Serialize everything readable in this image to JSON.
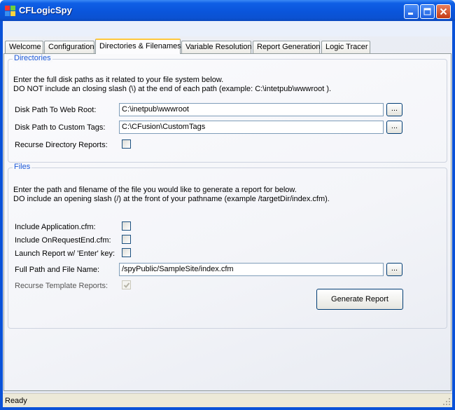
{
  "window": {
    "title": "CFLogicSpy"
  },
  "tabs": [
    {
      "label": "Welcome"
    },
    {
      "label": "Configuration"
    },
    {
      "label": "Directories & Filenames"
    },
    {
      "label": "Variable Resolution"
    },
    {
      "label": "Report Generation"
    },
    {
      "label": "Logic Tracer"
    }
  ],
  "directories": {
    "legend": "Directories",
    "instruction_1": "Enter the  full disk paths as it related to your file system below.",
    "instruction_2": "DO NOT include an closing slash (\\) at the end of each path  (example: C:\\intetpub\\wwwroot ).",
    "web_root_label": "Disk Path To Web Root:",
    "web_root_value": "C:\\inetpub\\wwwroot",
    "custom_tags_label": "Disk Path to Custom Tags:",
    "custom_tags_value": "C:\\CFusion\\CustomTags",
    "recurse_label": "Recurse Directory Reports:",
    "browse_label": "..."
  },
  "files": {
    "legend": "Files",
    "instruction_1": "Enter the path and filename of the file you would like to generate a report for below.",
    "instruction_2": "DO include an opening slash (/) at the front of your pathname  (example /targetDir/index.cfm).",
    "include_application_label": "Include Application.cfm:",
    "include_onrequestend_label": "Include OnRequestEnd.cfm:",
    "launch_enter_label": "Launch Report w/ 'Enter' key:",
    "full_path_label": "Full Path and File Name:",
    "full_path_value": "/spyPublic/SampleSite/index.cfm",
    "recurse_template_label": "Recurse Template Reports:",
    "browse_label": "...",
    "generate_button": "Generate Report"
  },
  "status": {
    "text": "Ready"
  }
}
